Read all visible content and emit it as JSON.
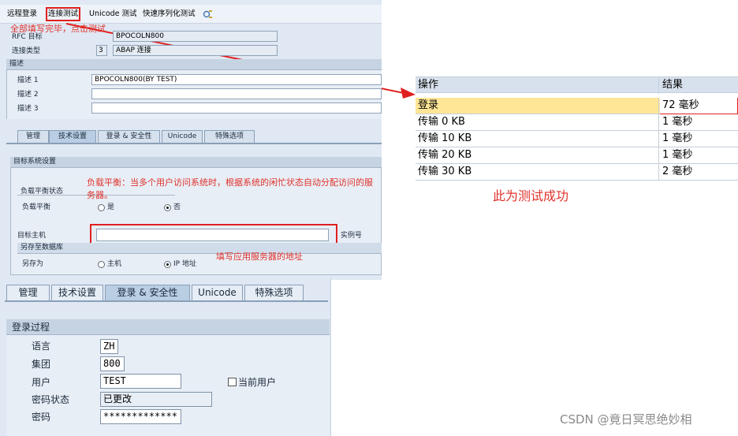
{
  "toolbar": {
    "remote_login": "远程登录",
    "connection_test": "连接测试",
    "unicode_test": "Unicode 测试",
    "fast_serialization_test": "快速序列化测试"
  },
  "notes": {
    "fill_complete": "全部填写完毕，点击测试",
    "load_balance": "负载平衡：当多个用户访问系统时，根据系统的闲忙状态自动分配访问的服务器。",
    "fill_server": "填写应用服务器的地址",
    "test_success": "此为测试成功"
  },
  "rfc": {
    "dest_label": "RFC 目标",
    "dest_value": "BPOCOLN800",
    "conn_type_label": "连接类型",
    "conn_type_code": "3",
    "conn_type_text": "ABAP 连接"
  },
  "description": {
    "header": "描述",
    "desc1_label": "描述 1",
    "desc1_value": "BPOCOLN800(BY TEST)",
    "desc2_label": "描述 2",
    "desc3_label": "描述 3"
  },
  "tabs_top": [
    "管理",
    "技术设置",
    "登录 & 安全性",
    "Unicode",
    "特殊选项"
  ],
  "target_system": {
    "header": "目标系统设置",
    "load_balance_status": "负载平衡状态",
    "load_balance_label": "负载平衡",
    "yes": "是",
    "no": "否",
    "target_host_label": "目标主机",
    "instance_label": "实例号",
    "save_to_db": "另存至数据库",
    "save_as_label": "另存为",
    "host_name": "主机",
    "ip_address": "IP 地址"
  },
  "tabs_bottom": [
    "管理",
    "技术设置",
    "登录 & 安全性",
    "Unicode",
    "特殊选项"
  ],
  "logon": {
    "header": "登录过程",
    "language_label": "语言",
    "language_value": "ZH",
    "client_label": "集团",
    "client_value": "800",
    "user_label": "用户",
    "user_value": "TEST",
    "current_user_label": "当前用户",
    "pw_status_label": "密码状态",
    "pw_status_value": "已更改",
    "password_label": "密码",
    "password_value": "*************"
  },
  "result_table": {
    "col_action": "操作",
    "col_result": "结果",
    "rows": [
      {
        "action": "登录",
        "result": "72 毫秒"
      },
      {
        "action": "传输 0 KB",
        "result": "1 毫秒"
      },
      {
        "action": "传输 10 KB",
        "result": "1 毫秒"
      },
      {
        "action": "传输 20 KB",
        "result": "1 毫秒"
      },
      {
        "action": "传输 30 KB",
        "result": "2 毫秒"
      }
    ]
  },
  "watermark": "CSDN @竟日冥思绝妙相",
  "colors": {
    "annotation_red": "#e0322b",
    "highlight_yellow": "#ffe697",
    "sap_panel": "#dfe8f3"
  }
}
